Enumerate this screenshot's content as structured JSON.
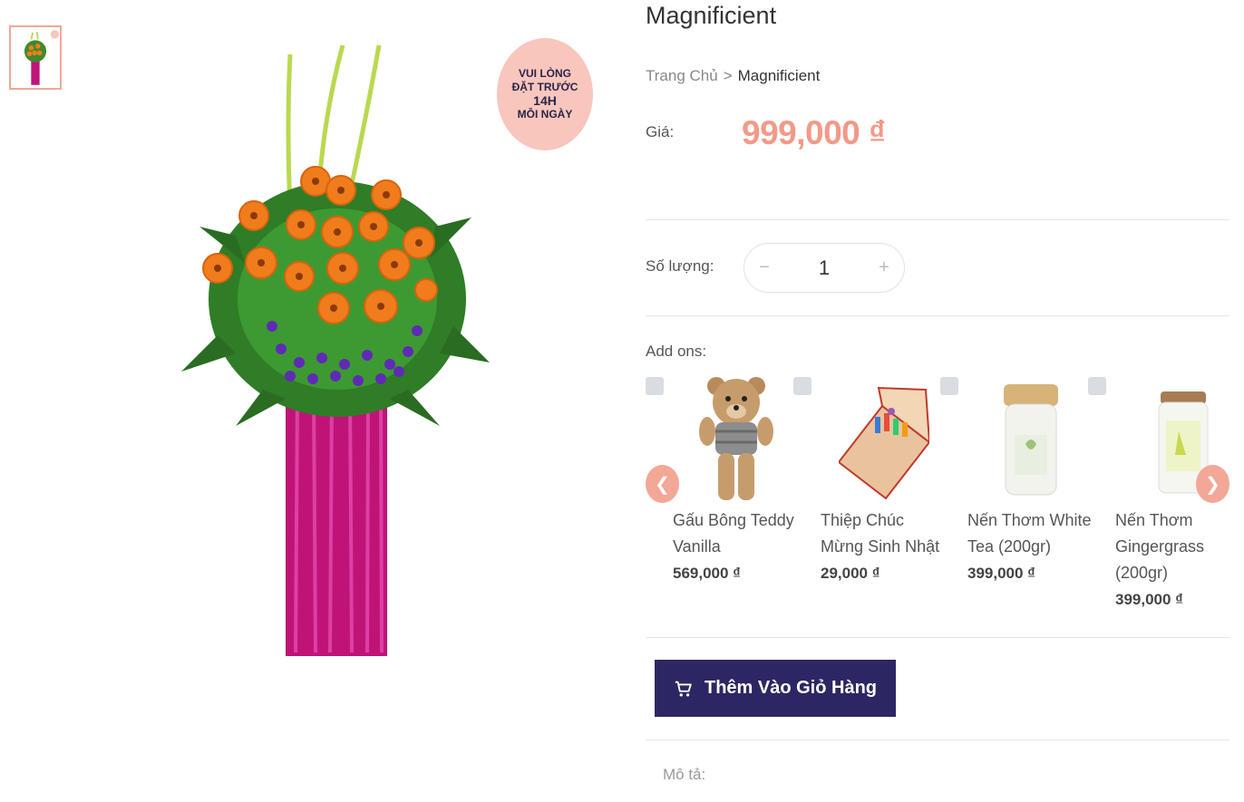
{
  "product": {
    "title": "Magnificient",
    "badge": {
      "line1": "VUI LÒNG",
      "line2": "ĐẶT TRƯỚC",
      "line3": "14H",
      "line4": "MỖI NGÀY"
    }
  },
  "breadcrumb": {
    "home": "Trang Chủ",
    "separator": ">",
    "current": "Magnificient"
  },
  "price": {
    "label": "Giá:",
    "value": "999,000 ₫"
  },
  "quantity": {
    "label": "Số lượng:",
    "value": "1",
    "minus": "−",
    "plus": "+"
  },
  "addons": {
    "label": "Add ons:",
    "items": [
      {
        "name": "Gấu Bông Teddy Vanilla",
        "price": "569,000 ₫"
      },
      {
        "name": "Thiệp Chúc Mừng Sinh Nhật",
        "price": "29,000 ₫"
      },
      {
        "name": "Nến Thơm White Tea (200gr)",
        "price": "399,000 ₫"
      },
      {
        "name": "Nến Thơm Gingergrass (200gr)",
        "price": "399,000 ₫"
      }
    ]
  },
  "cart_button": {
    "label": "Thêm Vào Giỏ Hàng"
  },
  "description": {
    "label": "Mô tả:"
  },
  "colors": {
    "accent": "#f19a88",
    "button": "#2c2764",
    "badge": "#f8c6bd"
  }
}
